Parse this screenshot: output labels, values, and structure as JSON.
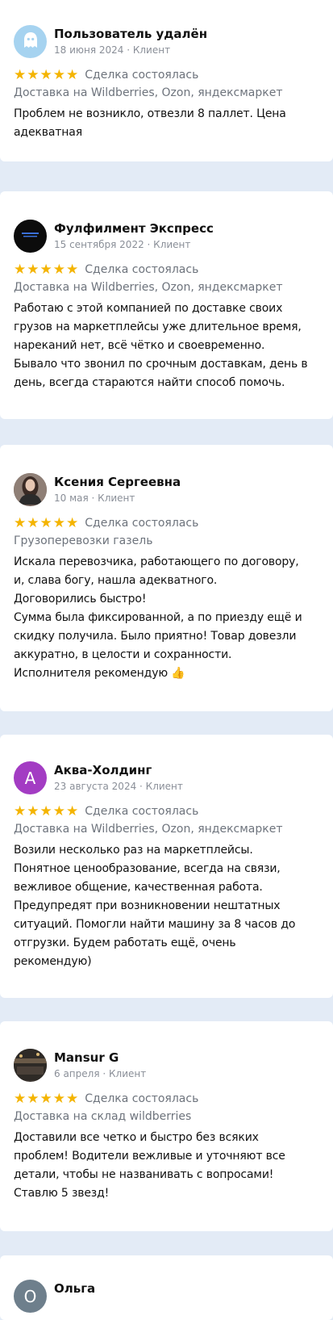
{
  "labels": {
    "deal_status": "Сделка состоялась"
  },
  "colors": {
    "star": "#f4b400",
    "background": "#e3ebf6",
    "card": "#ffffff"
  },
  "reviews": [
    {
      "author": "Пользователь удалён",
      "date": "18 июня 2024",
      "role": "Клиент",
      "avatar": {
        "kind": "ghost-icon",
        "bg": "#a6d3f0"
      },
      "rating": 5,
      "service": "Доставка на Wildberries, Ozon, яндексмаркет",
      "text_lines": [
        "Проблем не возникло, отвезли 8 паллет. Цена",
        "адекватная"
      ]
    },
    {
      "author": "Фулфилмент Экспресс",
      "date": "15 сентября 2022",
      "role": "Клиент",
      "avatar": {
        "kind": "logo",
        "bg": "#0c0c0c"
      },
      "rating": 5,
      "service": "Доставка на Wildberries, Ozon, яндексмаркет",
      "text_lines": [
        "Работаю с этой компанией по доставке своих",
        "грузов на маркетплейсы уже длительное время,",
        "нареканий нет, всё чётко и своевременно.",
        "Бывало что звонил по срочным доставкам, день в",
        "день, всегда стараются найти способ помочь."
      ]
    },
    {
      "author": "Ксения Сергеевна",
      "date": "10 мая",
      "role": "Клиент",
      "avatar": {
        "kind": "photo",
        "bg": "#6b5a52"
      },
      "rating": 5,
      "service": "Грузоперевозки газель",
      "text_lines": [
        "Искала перевозчика, работающего по договору,",
        "и, слава богу, нашла адекватного.",
        "Договорились быстро!",
        "Сумма была фиксированной, а по приезду ещё и",
        "скидку получила. Было приятно! Товар довезли",
        "аккуратно, в целости и сохранности.",
        "Исполнителя рекомендую 👍"
      ]
    },
    {
      "author": "Аква-Холдинг",
      "date": "23 августа 2024",
      "role": "Клиент",
      "avatar": {
        "kind": "letter",
        "letter": "А",
        "bg": "#a33cc3"
      },
      "rating": 5,
      "service": "Доставка на Wildberries, Ozon, яндексмаркет",
      "text_lines": [
        "Возили несколько раз на маркетплейсы.",
        "Понятное ценообразование, всегда на связи,",
        "вежливое общение, качественная работа.",
        "Предупредят при возникновении нештатных",
        "ситуаций. Помогли найти машину за 8 часов до",
        "отгрузки. Будем работать ещё, очень",
        "рекомендую)"
      ]
    },
    {
      "author": "Mansur G",
      "date": "6 апреля",
      "role": "Клиент",
      "avatar": {
        "kind": "photo",
        "bg": "#3b3530"
      },
      "rating": 5,
      "service": "Доставка на склад wildberries",
      "text_lines": [
        "Доставили все четко и быстро без всяких",
        "проблем! Водители вежливые и уточняют все",
        "детали, чтобы не названивать с вопросами!",
        "Ставлю 5 звезд!"
      ]
    },
    {
      "author": "Ольга",
      "date": "",
      "role": "",
      "avatar": {
        "kind": "letter",
        "letter": "О",
        "bg": "#6e7f8c"
      },
      "rating": 0,
      "service": "",
      "text_lines": []
    }
  ]
}
